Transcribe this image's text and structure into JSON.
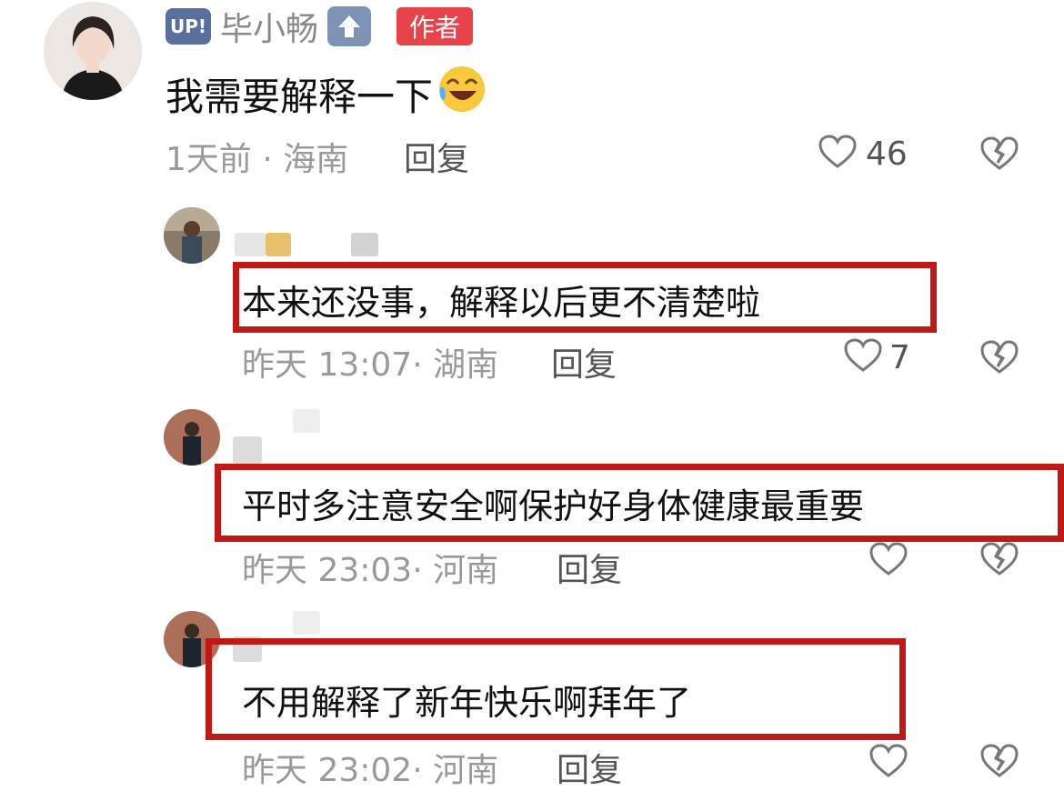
{
  "main_comment": {
    "up_badge": "UP!",
    "username": "毕小畅",
    "author_badge": "作者",
    "text": "我需要解释一下",
    "time_location": "1天前 · 海南",
    "reply_label": "回复",
    "likes": "46"
  },
  "replies": [
    {
      "text": "本来还没事，解释以后更不清楚啦",
      "time_location": "昨天 13:07· 湖南",
      "reply_label": "回复",
      "likes": "7"
    },
    {
      "text": "平时多注意安全啊保护好身体健康最重要",
      "time_location": "昨天 23:03· 河南",
      "reply_label": "回复",
      "likes": ""
    },
    {
      "text": "不用解释了新年快乐啊拜年了",
      "time_location": "昨天 23:02· 河南",
      "reply_label": "回复",
      "likes": ""
    }
  ],
  "colors": {
    "highlight_box": "#c01914",
    "author_badge": "#e8424b",
    "meta_text": "#9a9a9a"
  },
  "icons": [
    "heart-outline-icon",
    "broken-heart-icon",
    "up-arrow-icon"
  ]
}
